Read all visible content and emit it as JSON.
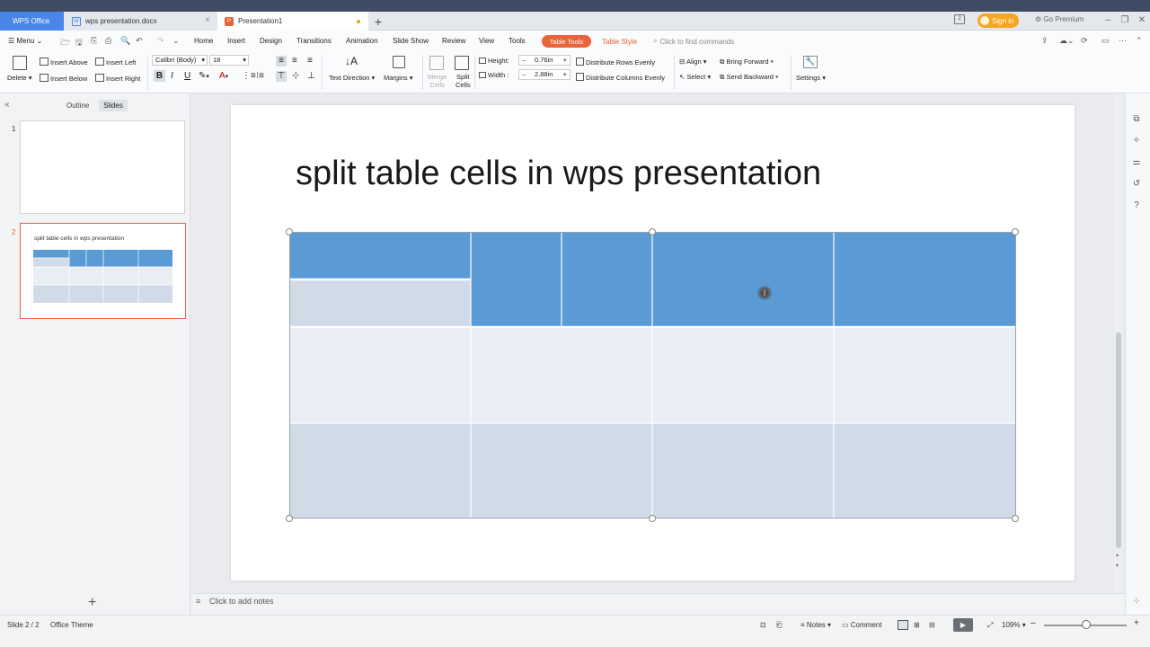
{
  "tabs": {
    "app": "WPS Office",
    "doc": "wps presentation.docx",
    "ppt": "Presentation1"
  },
  "account": {
    "signin": "Sign in",
    "premium": "Go Premium"
  },
  "menu": {
    "menu_label": "Menu",
    "items": [
      "Home",
      "Insert",
      "Design",
      "Transitions",
      "Animation",
      "Slide Show",
      "Review",
      "View",
      "Tools"
    ],
    "table_tools": "Table Tools",
    "table_style": "Table Style",
    "find_placeholder": "Click to find commands"
  },
  "ribbon": {
    "delete": "Delete",
    "insert_above": "Insert Above",
    "insert_below": "Insert Below",
    "insert_left": "Insert Left",
    "insert_right": "Insert Right",
    "font_name": "Calibri (Body)",
    "font_size": "18",
    "text_direction": "Text Direction",
    "margins": "Margins",
    "merge_cells_1": "Merge",
    "merge_cells_2": "Cells",
    "split_cells_1": "Split",
    "split_cells_2": "Cells",
    "height_label": "Height:",
    "height_value": "0.76in",
    "width_label": "Width :",
    "width_value": "2.88in",
    "distribute_rows": "Distribute Rows Evenly",
    "distribute_cols": "Distribute Columns Evenly",
    "align": "Align",
    "select": "Select",
    "bring_forward": "Bring Forward",
    "send_backward": "Send Backward",
    "settings": "Settings"
  },
  "leftpanel": {
    "outline_tab": "Outline",
    "slides_tab": "Slides",
    "slide1_num": "1",
    "slide2_num": "2",
    "slide2_title": "split table cells in wps presentation"
  },
  "slide": {
    "title": "split table cells in wps presentation"
  },
  "notes": {
    "placeholder": "Click to add notes"
  },
  "status": {
    "slide": "Slide 2 / 2",
    "theme": "Office Theme",
    "notes": "Notes",
    "comment": "Comment",
    "zoom": "109%"
  },
  "colors": {
    "accent": "#e8643a",
    "table_header": "#5b9bd5",
    "table_band_light": "#e9eef5",
    "table_band_dark": "#d1dbe8",
    "wps_blue": "#4a86e8",
    "signin": "#f5a623"
  }
}
